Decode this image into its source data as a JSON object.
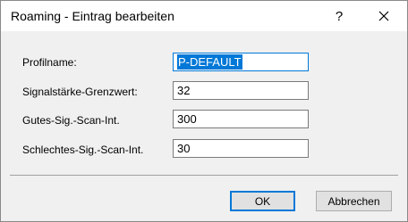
{
  "window": {
    "title": "Roaming - Eintrag bearbeiten",
    "help_glyph": "?",
    "close_glyph": "✕"
  },
  "form": {
    "fields": [
      {
        "label": "Profilname:",
        "value": "P-DEFAULT",
        "selected": true
      },
      {
        "label": "Signalstärke-Grenzwert:",
        "value": "32"
      },
      {
        "label": "Gutes-Sig.-Scan-Int.",
        "value": "300"
      },
      {
        "label": "Schlechtes-Sig.-Scan-Int.",
        "value": "30"
      }
    ]
  },
  "buttons": {
    "ok_label": "OK",
    "cancel_label": "Abbrechen"
  },
  "colors": {
    "accent": "#0078d7",
    "dialog_bg": "#f0f0f0"
  },
  "icons": {
    "help": "help-icon",
    "close": "close-icon"
  }
}
